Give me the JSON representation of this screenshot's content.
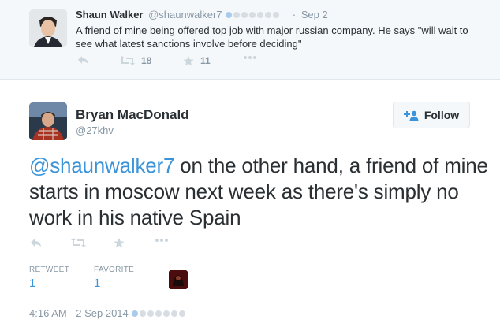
{
  "parent_tweet": {
    "name": "Shaun Walker",
    "handle": "@shaunwalker7",
    "separator": "·",
    "date": "Sep 2",
    "text": "A friend of mine being offered top job with major russian company. He says \"will wait to see what latest sanctions involve before deciding\"",
    "retweet_count": "18",
    "favorite_count": "11"
  },
  "main_tweet": {
    "name": "Bryan MacDonald",
    "handle": "@27khv",
    "follow_label": "Follow",
    "mention": "@shaunwalker7",
    "text": " on the other hand, a friend of mine starts in moscow next week as there's simply no work in his native Spain",
    "retweets_label": "RETWEET",
    "retweets_value": "1",
    "favorites_label": "FAVORITE",
    "favorites_value": "1",
    "timestamp": "4:16 AM - 2 Sep 2014"
  },
  "colors": {
    "link": "#3b94d9",
    "muted": "#8899a6",
    "icon": "#ccd6dd",
    "parent_bg": "#f5f8fa",
    "border": "#e1e8ed"
  },
  "icons": [
    "reply-icon",
    "retweet-icon",
    "favorite-icon",
    "more-icon",
    "follow-person-icon"
  ]
}
